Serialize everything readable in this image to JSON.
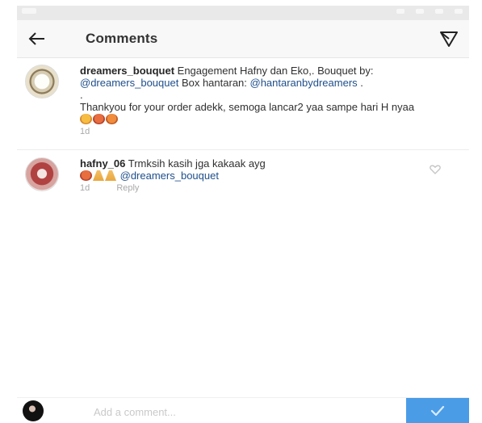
{
  "header": {
    "title": "Comments"
  },
  "comments": [
    {
      "username": "dreamers_bouquet",
      "text_1": " Engagement Hafny dan Eko,. Bouquet by: ",
      "mention_1": "@dreamers_bouquet",
      "text_2": " Box hantaran: ",
      "mention_2": "@hantaranbydreamers",
      "text_3": " .",
      "line_dot": ".",
      "text_4": "Thankyou for your order adekk, semoga lancar2 yaa sampe hari H nyaa",
      "time": "1d",
      "emojis": [
        "emoji-1",
        "emoji-2",
        "emoji-3"
      ]
    },
    {
      "username": "hafny_06",
      "text": " Trmksih kasih jga kakaak ayg ",
      "mention": "@dreamers_bouquet",
      "time": "1d",
      "reply_label": "Reply"
    }
  ],
  "composer": {
    "placeholder": "Add a comment..."
  },
  "colors": {
    "link": "#1f4f8b",
    "accent": "#4a9ce7",
    "muted": "#a9a9a9"
  },
  "icons": {
    "back": "arrow-left-icon",
    "send": "paper-plane-icon",
    "like": "heart-icon",
    "post": "checkmark-icon"
  }
}
